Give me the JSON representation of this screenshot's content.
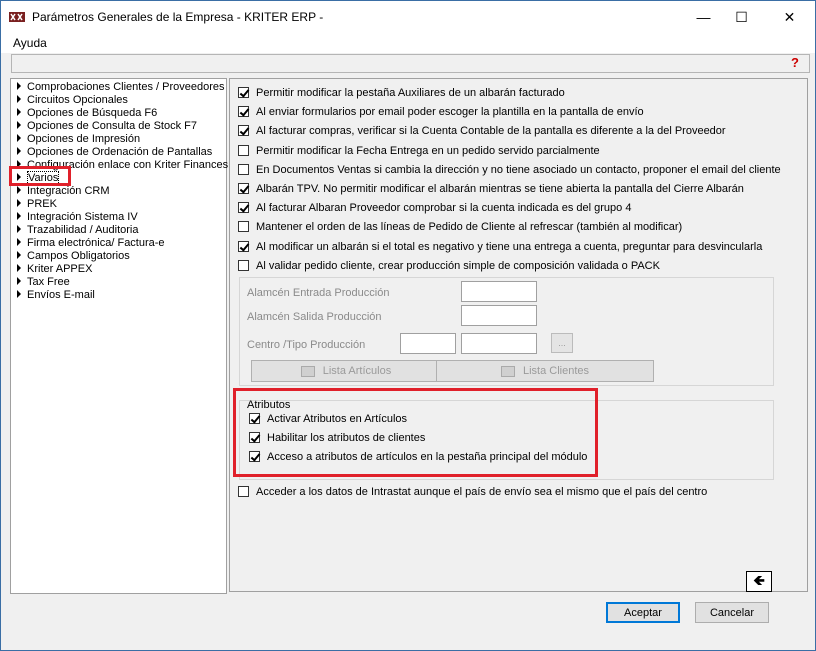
{
  "window": {
    "title": "Parámetros Generales de la Empresa - KRITER ERP -",
    "minimize": "—",
    "maximize": "☐",
    "close": "✕"
  },
  "menu": {
    "help": "Ayuda"
  },
  "tree": {
    "items": [
      {
        "label": "Comprobaciones Clientes / Proveedores"
      },
      {
        "label": "Circuitos Opcionales"
      },
      {
        "label": "Opciones de Búsqueda F6"
      },
      {
        "label": "Opciones de Consulta de Stock F7"
      },
      {
        "label": "Opciones de Impresión"
      },
      {
        "label": "Opciones de Ordenación de Pantallas"
      },
      {
        "label": "Configuración enlace con Kriter Finances"
      },
      {
        "label": "Varios",
        "selected": true
      },
      {
        "label": "Integración CRM"
      },
      {
        "label": "PREK"
      },
      {
        "label": "Integración Sistema IV"
      },
      {
        "label": "Trazabilidad / Auditoria"
      },
      {
        "label": "Firma electrónica/ Factura-e"
      },
      {
        "label": "Campos Obligatorios"
      },
      {
        "label": "Kriter APPEX"
      },
      {
        "label": "Tax Free"
      },
      {
        "label": "Envíos E-mail"
      }
    ]
  },
  "options": [
    {
      "label": "Permitir modificar la pestaña Auxiliares de un albarán facturado",
      "checked": true
    },
    {
      "label": "Al enviar formularios por email poder escoger la plantilla en la pantalla de envío",
      "checked": true
    },
    {
      "label": "Al facturar compras, verificar si la Cuenta Contable de la pantalla es diferente a la del Proveedor",
      "checked": true
    },
    {
      "label": "Permitir modificar la Fecha Entrega en un pedido servido parcialmente",
      "checked": false
    },
    {
      "label": "En Documentos Ventas si cambia la dirección y no tiene asociado un contacto, proponer el email del cliente",
      "checked": false
    },
    {
      "label": "Albarán TPV. No permitir modificar el albarán mientras se tiene abierta la pantalla del Cierre Albarán",
      "checked": true
    },
    {
      "label": "Al facturar Albaran Proveedor comprobar si la cuenta indicada es del grupo 4",
      "checked": true
    },
    {
      "label": "Mantener el orden de las líneas de Pedido de Cliente al refrescar (también al modificar)",
      "checked": false
    },
    {
      "label": "Al modificar un albarán si el total es negativo y tiene una entrega a cuenta, preguntar para desvincularla",
      "checked": true
    },
    {
      "label": "Al validar pedido cliente, crear producción simple de composición validada o PACK",
      "checked": false
    }
  ],
  "production": {
    "entrada_label": "Alamcén Entrada Producción",
    "salida_label": "Alamcén Salida Producción",
    "centro_label": "Centro /Tipo Producción",
    "dots": "...",
    "lista_articulos": "Lista Artículos",
    "lista_clientes": "Lista Clientes"
  },
  "atributos": {
    "legend": "Atributos",
    "items": [
      {
        "label": "Activar Atributos en Artículos",
        "checked": true
      },
      {
        "label": "Habilitar los atributos de clientes",
        "checked": true
      },
      {
        "label": "Acceso a atributos de artículos en la pestaña principal del módulo",
        "checked": true
      }
    ]
  },
  "intrastat": {
    "label": "Acceder a los datos de Intrastat aunque el país de envío sea el mismo que el país del centro",
    "checked": false
  },
  "buttons": {
    "accept": "Aceptar",
    "cancel": "Cancelar",
    "nav_arrow": "🡸"
  },
  "colors": {
    "highlight": "#e0202a",
    "window_border": "#3a6ea5"
  }
}
